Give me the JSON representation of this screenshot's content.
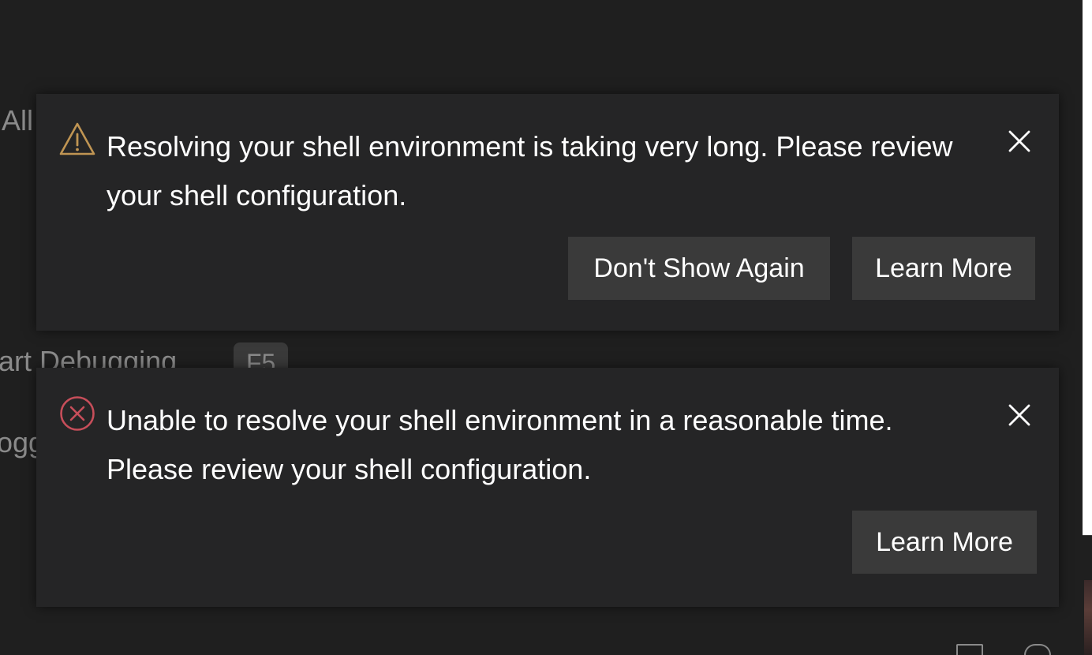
{
  "background": {
    "fragment_all": "All",
    "fragment_debugging": "art Debugging",
    "fragment_key": "F5",
    "fragment_logg": "ogg"
  },
  "notifications": [
    {
      "severity": "warning",
      "icon": "warning-icon",
      "color": "#c09553",
      "message": "Resolving your shell environment is taking very long. Please review your shell configuration.",
      "close_label": "Close",
      "buttons": [
        "Don't Show Again",
        "Learn More"
      ]
    },
    {
      "severity": "error",
      "icon": "error-icon",
      "color": "#c74e5a",
      "message": "Unable to resolve your shell environment in a reasonable time. Please review your shell configuration.",
      "close_label": "Close",
      "buttons": [
        "Learn More"
      ]
    }
  ],
  "colors": {
    "background": "#1f1f1f",
    "toast_background": "#252526",
    "button_background": "#3a3a3a",
    "text": "#ffffff",
    "muted_text": "#8a8a8a"
  }
}
